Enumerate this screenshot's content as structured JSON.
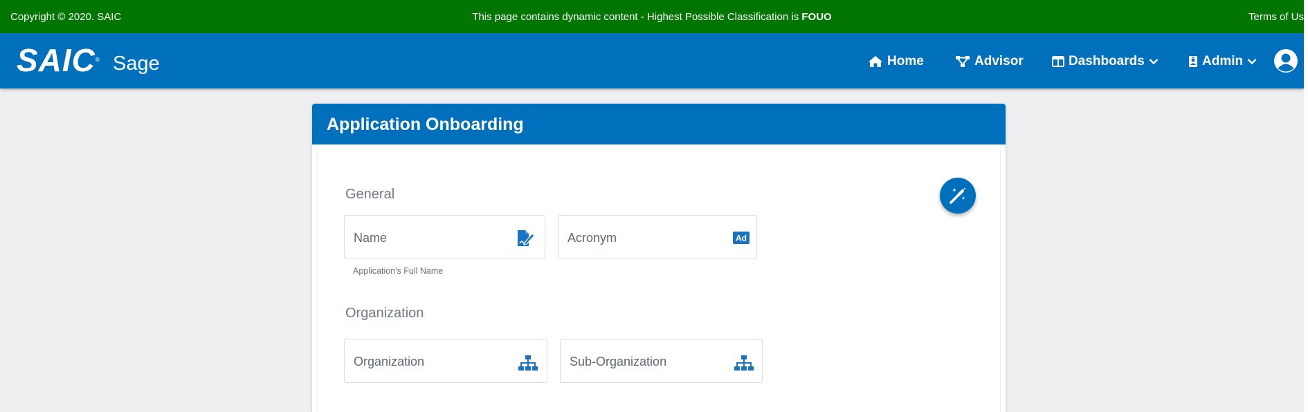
{
  "banner": {
    "copyright": "Copyright © 2020. SAIC",
    "notice_prefix": "This page contains dynamic content - Highest Possible Classification is ",
    "classification": "FOUO",
    "terms": "Terms of Us"
  },
  "navbar": {
    "logo_text": "SAIC",
    "app_name": "Sage",
    "items": [
      {
        "label": "Home",
        "icon": "home-icon"
      },
      {
        "label": "Advisor",
        "icon": "network-nodes-icon"
      },
      {
        "label": "Dashboards",
        "icon": "columns-icon",
        "dropdown": true
      },
      {
        "label": "Admin",
        "icon": "id-badge-icon",
        "dropdown": true
      }
    ],
    "user_icon": "user-circle-icon"
  },
  "card": {
    "title": "Application Onboarding",
    "sections": {
      "general": {
        "label": "General",
        "name_placeholder": "Name",
        "name_hint": "Application's Full Name",
        "acronym_placeholder": "Acronym"
      },
      "organization": {
        "label": "Organization",
        "organization_placeholder": "Organization",
        "sub_organization_placeholder": "Sub-Organization"
      }
    },
    "fab_icon": "magic-wand-icon"
  },
  "colors": {
    "banner_green": "#007500",
    "primary_blue": "#0070bd",
    "page_bg": "#efeff1"
  }
}
